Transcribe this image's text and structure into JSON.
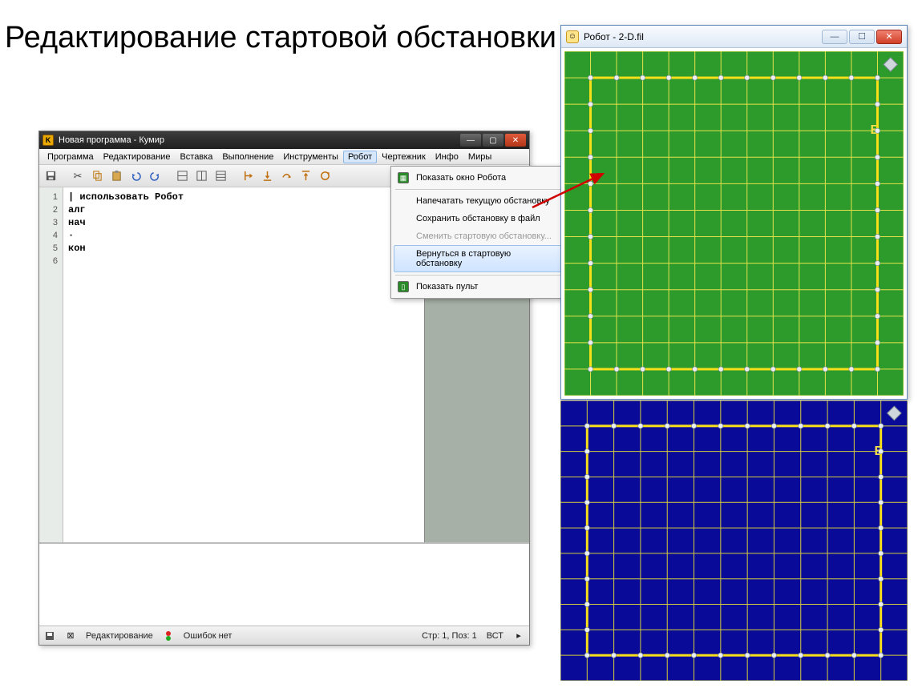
{
  "slide_title": "Редактирование стартовой обстановки",
  "kumir": {
    "title": "Новая программа - Кумир",
    "menu": [
      "Программа",
      "Редактирование",
      "Вставка",
      "Выполнение",
      "Инструменты",
      "Робот",
      "Чертежник",
      "Инфо",
      "Миры"
    ],
    "active_menu_index": 5,
    "code_lines": [
      "| использовать Робот",
      "алг",
      "нач",
      "·",
      "кон",
      ""
    ],
    "line_numbers": [
      "1",
      "2",
      "3",
      "4",
      "5",
      "6"
    ],
    "status": {
      "mode": "Редактирование",
      "errors": "Ошибок нет",
      "cursor": "Стр: 1, Поз: 1",
      "ins": "ВСТ"
    }
  },
  "dropdown": {
    "items": [
      {
        "label": "Показать окно Робота",
        "icon": "grid",
        "kind": "item"
      },
      {
        "kind": "sep"
      },
      {
        "label": "Напечатать текущую обстановку",
        "kind": "item"
      },
      {
        "label": "Сохранить обстановку в файл",
        "kind": "item"
      },
      {
        "label": "Сменить стартовую обстановку...",
        "kind": "item",
        "disabled": true
      },
      {
        "label": "Вернуться в стартовую обстановку",
        "kind": "item",
        "highlight": true
      },
      {
        "kind": "sep"
      },
      {
        "label": "Показать пульт",
        "icon": "pult",
        "kind": "item"
      }
    ]
  },
  "robot_window": {
    "title": "Робот - 2-D.fil",
    "field_label": "Б"
  },
  "blue_field": {
    "field_label": "Б"
  },
  "grid": {
    "cols": 13,
    "rows": 13,
    "thick_walls_cols_inner": [
      1,
      12
    ],
    "thick_walls_rows_inner": [
      1,
      12
    ],
    "dots_on_inner_border": true
  }
}
